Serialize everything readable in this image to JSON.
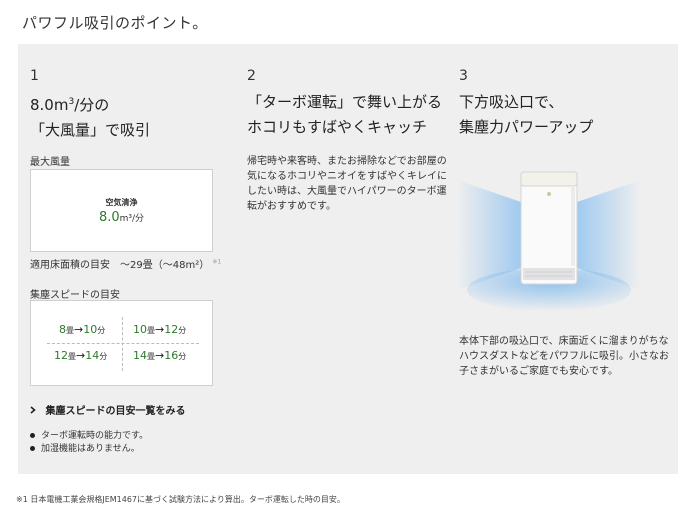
{
  "page": {
    "title": "パワフル吸引のポイント。"
  },
  "points": [
    {
      "number": "1",
      "heading_line1_prefix": "8.0m",
      "heading_line1_sup": "3",
      "heading_line1_suffix": "/分の",
      "heading_line2": "「大風量」で吸引",
      "max_airflow_label": "最大風量",
      "airflow_caption": "空気清浄",
      "airflow_value": "8.0",
      "airflow_unit": "m³/分",
      "floor_area_text": "適用床面積の目安　〜29畳（〜48m²）",
      "floor_area_note": "※1",
      "speed_label": "集塵スピードの目安",
      "speeds": [
        {
          "from": "8",
          "to": "10"
        },
        {
          "from": "10",
          "to": "12"
        },
        {
          "from": "12",
          "to": "14"
        },
        {
          "from": "14",
          "to": "16"
        }
      ],
      "speed_unit_tatami": "畳",
      "speed_arrow": "→",
      "speed_unit_min": "分",
      "speed_link_label": "集塵スピードの目安一覧をみる",
      "notes": [
        "ターボ運転時の能力です。",
        "加湿機能はありません。"
      ]
    },
    {
      "number": "2",
      "heading_line1": "「ターボ運転」で舞い上がる",
      "heading_line2": "ホコリもすばやくキャッチ",
      "description": "帰宅時や来客時、またお掃除などでお部屋の気になるホコリやニオイをすばやくキレイにしたい時は、大風量でハイパワーのターボ運転がおすすめです。"
    },
    {
      "number": "3",
      "heading_line1": "下方吸込口で、",
      "heading_line2": "集塵力パワーアップ",
      "description": "本体下部の吸込口で、床面近くに溜まりがちなハウスダストなどをパワフルに吸引。小さなお子さまがいるご家庭でも安心です。"
    }
  ],
  "footnote": "※1 日本電機工業会規格JEM1467に基づく試験方法により算出。ターボ運転した時の目安。",
  "colors": {
    "panel_bg": "#efefef",
    "accent_green": "#2c7a2c",
    "airflow_blue": "#9cc8ef"
  },
  "icons": {
    "link": "chevron-right-icon",
    "note": "bullet-icon"
  }
}
